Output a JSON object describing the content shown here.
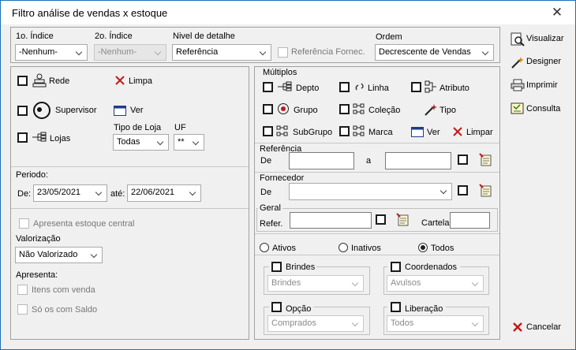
{
  "window": {
    "title": "Filtro análise de vendas x estoque",
    "close": "✕"
  },
  "top": {
    "indice1": {
      "label": "1o. Índice",
      "value": "-Nenhum-"
    },
    "indice2": {
      "label": "2o. Índice",
      "value": "-Nenhum-"
    },
    "nivel": {
      "label": "Nivel de detalhe",
      "value": "Referência"
    },
    "ref_fornec": {
      "label": "Referência Fornec."
    },
    "ordem": {
      "label": "Ordem",
      "value": "Decrescente de Vendas"
    }
  },
  "left": {
    "rede": "Rede",
    "limpa": "Limpa",
    "supervisor": "Supervisor",
    "ver": "Ver",
    "lojas": "Lojas",
    "tipo_loja": {
      "label": "Tipo de Loja",
      "value": "Todas"
    },
    "uf": {
      "label": "UF",
      "value": "**"
    },
    "periodo": {
      "label": "Periodo:",
      "de_label": "De:",
      "de_value": "23/05/2021",
      "ate_label": "até:",
      "ate_value": "22/06/2021"
    },
    "estoque_central": "Apresenta estoque central",
    "valorizacao": {
      "label": "Valorização",
      "value": "Não Valorizado"
    },
    "apresenta": "Apresenta:",
    "itens_venda": "Itens com venda",
    "so_saldo": "Só os com Saldo"
  },
  "multiplos": {
    "title": "Múltiplos",
    "depto": "Depto",
    "linha": "Linha",
    "atributo": "Atributo",
    "grupo": "Grupo",
    "colecao": "Coleção",
    "tipo": "Tipo",
    "subgrupo": "SubGrupo",
    "marca": "Marca",
    "ver": "Ver",
    "limpar": "Limpar"
  },
  "referencia": {
    "title": "Referência",
    "de": "De",
    "a": "a"
  },
  "fornecedor": {
    "title": "Fornecedor",
    "de": "De"
  },
  "geral": {
    "title": "Geral",
    "refer": "Refer.",
    "cartela": "Cartela"
  },
  "status": {
    "ativos": "Ativos",
    "inativos": "Inativos",
    "todos": "Todos"
  },
  "groups": {
    "brindes": {
      "label": "Brindes",
      "value": "Brindes"
    },
    "coordenados": {
      "label": "Coordenados",
      "value": "Avulsos"
    },
    "opcao": {
      "label": "Opção",
      "value": "Comprados"
    },
    "liberacao": {
      "label": "Liberação",
      "value": "Todos"
    }
  },
  "sidebar": {
    "visualizar": "Visualizar",
    "designer": "Designer",
    "imprimir": "Imprimir",
    "consulta": "Consulta",
    "cancelar": "Cancelar"
  }
}
